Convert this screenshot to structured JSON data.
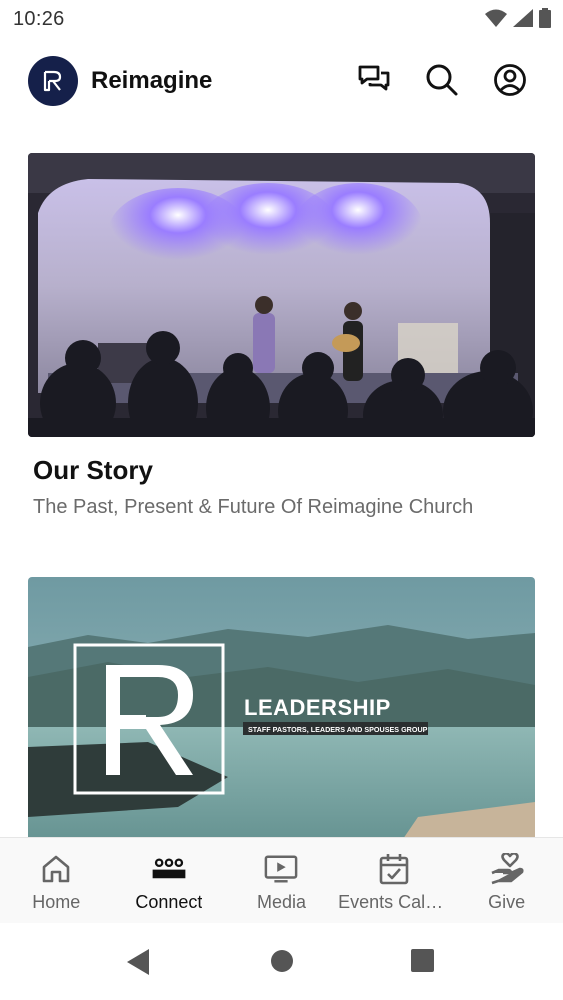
{
  "status_bar": {
    "time": "10:26",
    "icons": [
      "wifi-icon",
      "cellular-signal-icon",
      "battery-icon"
    ]
  },
  "header": {
    "app_title": "Reimagine",
    "logo_icon": "reimagine-logo-icon",
    "actions": [
      "chat-icon",
      "search-icon",
      "profile-icon"
    ]
  },
  "feed": {
    "cards": [
      {
        "title": "Our Story",
        "subtitle": "The Past, Present & Future Of Reimagine Church",
        "image": "worship-stage-photo"
      },
      {
        "title": "",
        "subtitle": "",
        "image": "leadership-lake-photo",
        "overlay_title": "LEADERSHIP",
        "overlay_subtitle": "STAFF PASTORS, LEADERS AND SPOUSES GROUP"
      }
    ]
  },
  "bottom_nav": {
    "active_index": 1,
    "items": [
      {
        "label": "Home",
        "icon": "home-icon"
      },
      {
        "label": "Connect",
        "icon": "people-icon"
      },
      {
        "label": "Media",
        "icon": "play-icon"
      },
      {
        "label": "Events Calendar",
        "icon": "calendar-icon"
      },
      {
        "label": "Give",
        "icon": "give-heart-icon"
      }
    ]
  },
  "system_nav": [
    "back-icon",
    "home-circle-icon",
    "recents-icon"
  ],
  "colors": {
    "logo_bg": "#15204a",
    "active_nav": "#111111",
    "inactive_nav": "#666666",
    "subtitle": "#6b6b6b"
  }
}
